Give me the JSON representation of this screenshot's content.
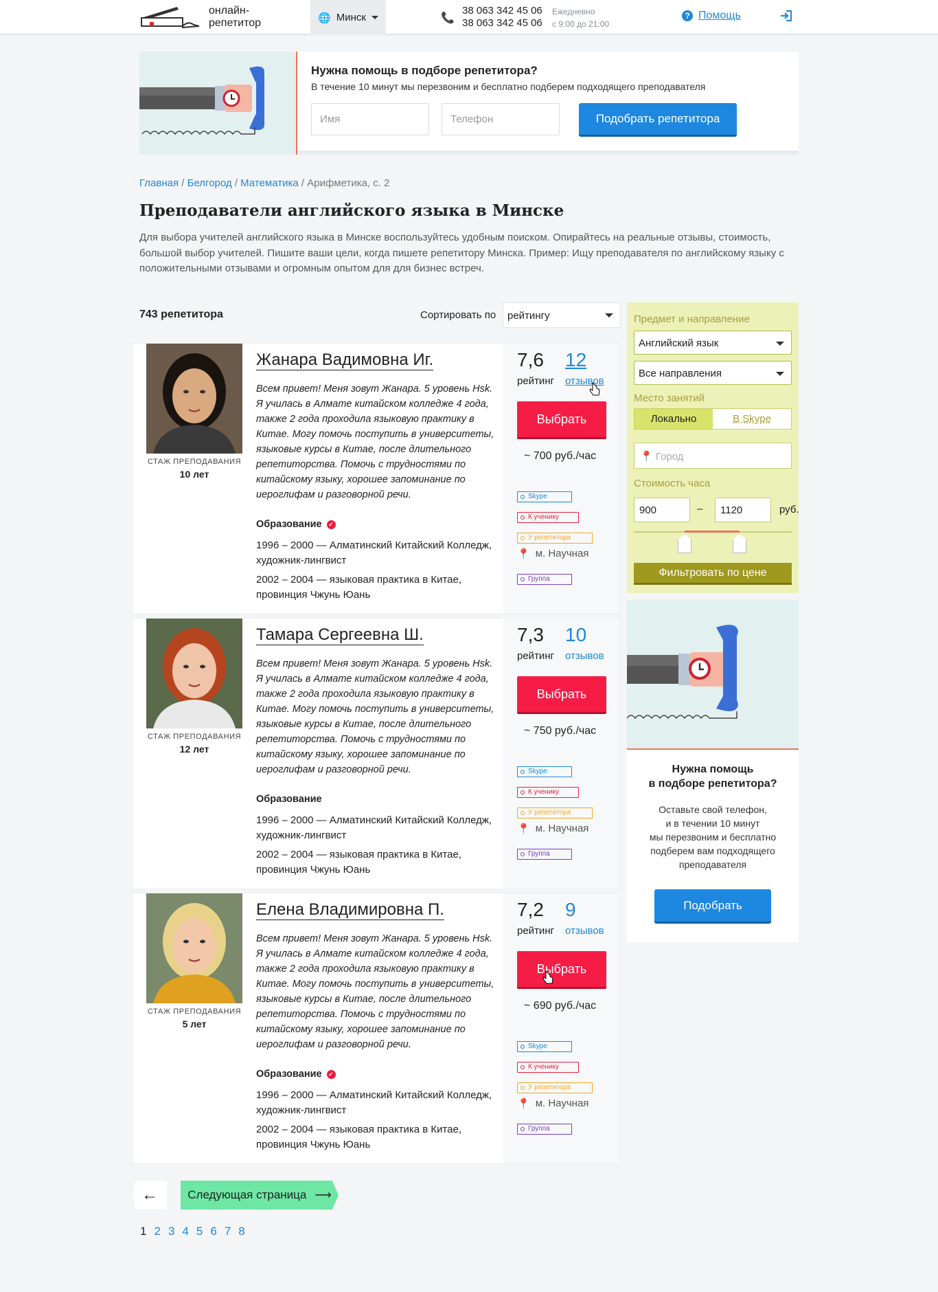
{
  "header": {
    "logo_text": "онлайн-\nрепетитор",
    "city": "Минск",
    "phones": [
      "38 063 342 45 06",
      "38 063 342 45 06"
    ],
    "hours": [
      "Ежедневно",
      "с 9:00 до 21:00"
    ],
    "help": "Помощь"
  },
  "promo": {
    "title": "Нужна помощь в подборе репетитора?",
    "text": "В течение 10 минут мы перезвоним и бесплатно подберем подходящего преподавателя",
    "name_placeholder": "Имя",
    "phone_placeholder": "Телефон",
    "button": "Подобрать репетитора"
  },
  "breadcrumbs": {
    "items": [
      "Главная",
      "Белгород",
      "Математика"
    ],
    "current": "Арифметика, с. 2"
  },
  "page": {
    "title": "Преподаватели английского языка в Минске",
    "intro": "Для выбора учителей английского языка в Минске воспользуйтесь удобным поиском. Опирайтесь на реальные отзывы, стоимость, большой выбор учителей. Пишите ваши цели, когда пишете репетитору Минска. Пример: Ищу преподавателя по английскому языку с положительными отзывами и огромным опытом для для бизнес встреч.",
    "count": "743 репетитора",
    "sort_label": "Сортировать по",
    "sort_value": "рейтингу"
  },
  "tutors": [
    {
      "name": "Жанара Вадимовна Иг.",
      "stazh_label": "СТАЖ ПРЕПОДАВАНИЯ",
      "stazh": "10 лет",
      "about": "Всем привет! Меня зовут Жанара. 5 уровень Hsk. Я училась в Алмате китайском колледже 4 года, также 2 года проходила языковую практику в Китае. Могу помочь поступить в университеты, языковые курсы в Китае, после длительного репетиторства. Помочь с трудностями по китайскому языку, хорошее запоминание по иероглифам и разговорной речи.",
      "edu_title": "Образование",
      "edu": [
        "1996 – 2000 — Алматинский Китайский Колледж, художник-лингвист",
        "2002 – 2004 — языковая практика в Китае, провинция Чжунь Юань"
      ],
      "rating": "7,6",
      "rating_label": "рейтинг",
      "reviews": "12",
      "reviews_label": "отзывов",
      "button": "Выбрать",
      "price": "~ 700 руб./час",
      "tags": [
        "Skype",
        "К ученику",
        "У репетитора",
        "Группа"
      ],
      "metro": "м. Научная"
    },
    {
      "name": "Тамара Сергеевна Ш.",
      "stazh_label": "СТАЖ ПРЕПОДАВАНИЯ",
      "stazh": "12 лет",
      "about": "Всем привет! Меня зовут Жанара. 5 уровень Hsk. Я училась в Алмате китайском колледже 4 года, также 2 года проходила языковую практику в Китае. Могу помочь поступить в университеты, языковые курсы в Китае, после длительного репетиторства. Помочь с трудностями по китайскому языку, хорошее запоминание по иероглифам и разговорной речи.",
      "edu_title": "Образование",
      "edu": [
        "1996 – 2000 — Алматинский Китайский Колледж, художник-лингвист",
        "2002 – 2004 — языковая практика в Китае, провинция Чжунь Юань"
      ],
      "rating": "7,3",
      "rating_label": "рейтинг",
      "reviews": "10",
      "reviews_label": "отзывов",
      "button": "Выбрать",
      "price": "~ 750 руб./час",
      "tags": [
        "Skype",
        "К ученику",
        "У репетитора",
        "Группа"
      ],
      "metro": "м. Научная"
    },
    {
      "name": "Елена Владимировна П.",
      "stazh_label": "СТАЖ ПРЕПОДАВАНИЯ",
      "stazh": "5 лет",
      "about": "Всем привет! Меня зовут Жанара. 5 уровень Hsk. Я училась в Алмате китайском колледже 4 года, также 2 года проходила языковую практику в Китае. Могу помочь поступить в университеты, языковые курсы в Китае, после длительного репетиторства. Помочь с трудностями по китайскому языку, хорошее запоминание по иероглифам и разговорной речи.",
      "edu_title": "Образование",
      "edu": [
        "1996 – 2000 — Алматинский Китайский Колледж, художник-лингвист",
        "2002 – 2004 — языковая практика в Китае, провинция Чжунь Юань"
      ],
      "rating": "7,2",
      "rating_label": "рейтинг",
      "reviews": "9",
      "reviews_label": "отзывов",
      "button": "Выбрать",
      "price": "~ 690 руб./час",
      "tags": [
        "Skype",
        "К ученику",
        "У репетитора",
        "Группа"
      ],
      "metro": "м. Научная"
    }
  ],
  "pagination": {
    "prev": "←",
    "next": "Следующая страница",
    "next_arrow": "⟶",
    "pages": [
      "1",
      "2",
      "3",
      "4",
      "5",
      "6",
      "7",
      "8"
    ],
    "current": "1"
  },
  "filter": {
    "subject_label": "Предмет и направление",
    "subject": "Английский язык",
    "direction": "Все направления",
    "place_label": "Место занятий",
    "place_local": "Локально",
    "place_skype": "В Skype",
    "city_placeholder": "Город",
    "price_label": "Стоимость часа",
    "price_from": "900",
    "price_dash": "–",
    "price_to": "1120",
    "currency": "руб.",
    "button": "Фильтровать по цене"
  },
  "help_box": {
    "title": "Нужна помощь\nв подборе репетитора?",
    "text": "Оставьте свой телефон,\nи в течении 10 минут\nмы перезвоним и бесплатно подберем вам подходящего преподавателя",
    "button": "Подобрать"
  },
  "colors": {
    "accent_blue": "#1e88e0",
    "red": "#f51d45",
    "filter_bg": "#ecf1b8",
    "next_green": "#6ee7a4",
    "tag_skype": "#1e88d8",
    "tag_student": "#e91e3c",
    "tag_tutor": "#f5a623",
    "tag_group": "#7b3fc4"
  }
}
